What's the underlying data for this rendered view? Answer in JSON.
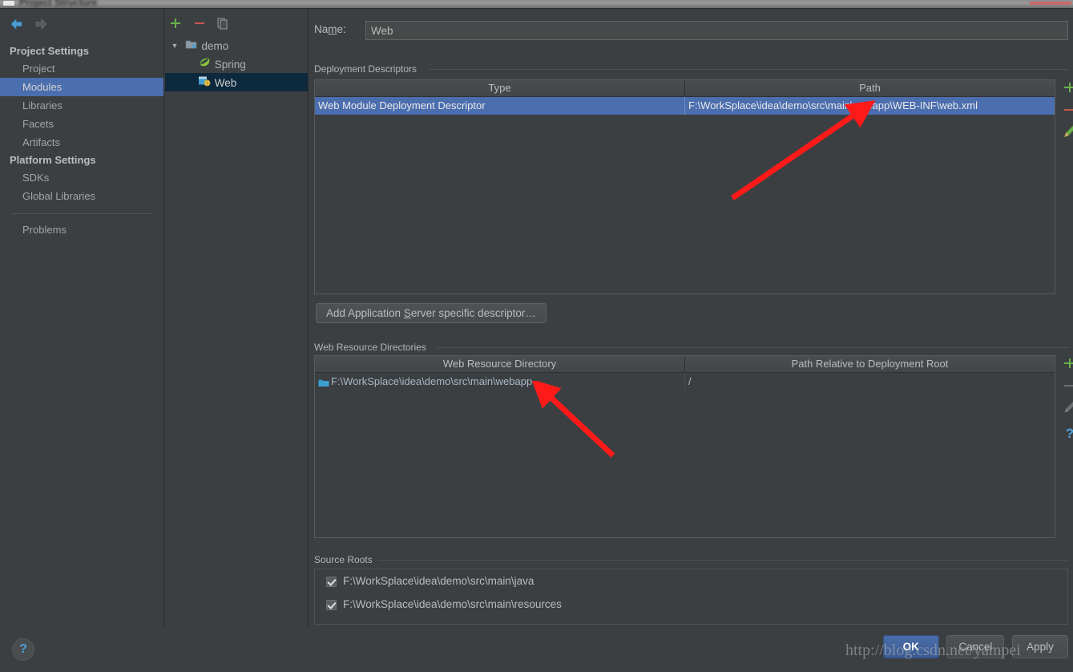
{
  "window": {
    "title": "Project Structure"
  },
  "sidebar": {
    "nav": {
      "back": "back-arrow",
      "forward": "forward-arrow"
    },
    "groups": [
      {
        "label": "Project Settings",
        "items": [
          {
            "label": "Project",
            "selected": false
          },
          {
            "label": "Modules",
            "selected": true
          },
          {
            "label": "Libraries",
            "selected": false
          },
          {
            "label": "Facets",
            "selected": false
          },
          {
            "label": "Artifacts",
            "selected": false
          }
        ]
      },
      {
        "label": "Platform Settings",
        "items": [
          {
            "label": "SDKs",
            "selected": false
          },
          {
            "label": "Global Libraries",
            "selected": false
          }
        ]
      }
    ],
    "problems_label": "Problems"
  },
  "tree": {
    "toolbar": [
      {
        "name": "add-module-button",
        "glyph": "+"
      },
      {
        "name": "remove-module-button",
        "glyph": "–"
      },
      {
        "name": "copy-module-button",
        "glyph": "copy"
      }
    ],
    "nodes": [
      {
        "label": "demo",
        "level": 0,
        "icon": "module-folder-icon",
        "expanded": true,
        "selected": false
      },
      {
        "label": "Spring",
        "level": 1,
        "icon": "spring-leaf-icon",
        "expanded": false,
        "selected": false
      },
      {
        "label": "Web",
        "level": 1,
        "icon": "web-facet-icon",
        "expanded": false,
        "selected": true
      }
    ]
  },
  "content": {
    "name_label_pre": "Na",
    "name_label_mnemonic": "m",
    "name_label_post": "e:",
    "name_value": "Web",
    "deployment": {
      "group_label": "Deployment Descriptors",
      "columns": [
        "Type",
        "Path"
      ],
      "rows": [
        {
          "type": "Web Module Deployment Descriptor",
          "path": "F:\\WorkSplace\\idea\\demo\\src\\main\\webapp\\WEB-INF\\web.xml",
          "selected": true
        }
      ],
      "tools": [
        {
          "name": "add-descriptor-button",
          "glyph": "+",
          "state": "enabled"
        },
        {
          "name": "remove-descriptor-button",
          "glyph": "–",
          "state": "enabled"
        },
        {
          "name": "edit-descriptor-button",
          "glyph": "pencil",
          "state": "enabled"
        }
      ],
      "add_button_pre": "Add Application ",
      "add_button_mnemonic": "S",
      "add_button_post": "erver specific descriptor…"
    },
    "web_resources": {
      "group_label": "Web Resource Directories",
      "columns": [
        "Web Resource Directory",
        "Path Relative to Deployment Root"
      ],
      "rows": [
        {
          "directory": "F:\\WorkSplace\\idea\\demo\\src\\main\\webapp",
          "relative_path": "/",
          "icon": "folder-icon"
        }
      ],
      "tools": [
        {
          "name": "add-web-resource-button",
          "glyph": "+",
          "state": "enabled"
        },
        {
          "name": "remove-web-resource-button",
          "glyph": "–",
          "state": "disabled"
        },
        {
          "name": "edit-web-resource-button",
          "glyph": "pencil",
          "state": "disabled"
        },
        {
          "name": "web-resource-help-button",
          "glyph": "?",
          "state": "enabled"
        }
      ]
    },
    "source_roots": {
      "group_label": "Source Roots",
      "rows": [
        {
          "path": "F:\\WorkSplace\\idea\\demo\\src\\main\\java",
          "checked": true
        },
        {
          "path": "F:\\WorkSplace\\idea\\demo\\src\\main\\resources",
          "checked": true
        }
      ]
    }
  },
  "footer": {
    "help": "?",
    "ok": "OK",
    "cancel": "Cancel",
    "apply": "Apply"
  },
  "watermark": "http://blog.csdn.net/yampei",
  "colors": {
    "background": "#3c3f41",
    "selection_blue": "#4b6eaf",
    "tree_selection": "#0d293e",
    "accent_green": "#5aa75a",
    "accent_red": "#c75450",
    "accent_blue": "#4e9fd8",
    "text": "#a9b7c6",
    "annotation_red": "#ff1a1a"
  }
}
